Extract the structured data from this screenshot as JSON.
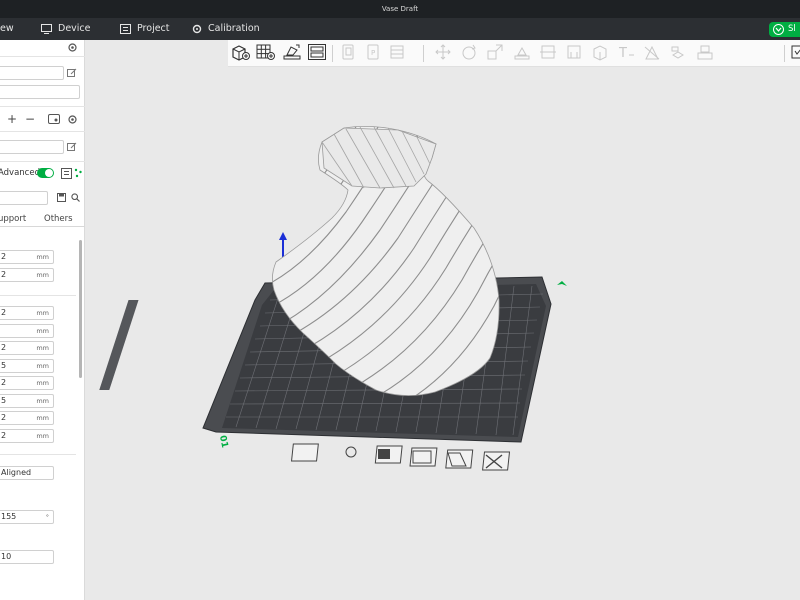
{
  "window": {
    "title": "Vase Draft"
  },
  "menu": {
    "view_label": "ew",
    "device_label": "Device",
    "project_label": "Project",
    "calibration_label": "Calibration",
    "slice_label": "Sl"
  },
  "sidebar": {
    "advanced_label": "Advanced",
    "tabs": {
      "support": "upport",
      "others": "Others"
    },
    "fields": [
      {
        "value": "2",
        "unit": "mm"
      },
      {
        "value": "2",
        "unit": "mm"
      },
      {
        "value": "2",
        "unit": "mm"
      },
      {
        "value": "",
        "unit": "mm"
      },
      {
        "value": "2",
        "unit": "mm"
      },
      {
        "value": "5",
        "unit": "mm"
      },
      {
        "value": "2",
        "unit": "mm"
      },
      {
        "value": "5",
        "unit": "mm"
      },
      {
        "value": "2",
        "unit": "mm"
      },
      {
        "value": "2",
        "unit": "mm"
      }
    ],
    "seam_value": "Aligned",
    "angle_value": "155",
    "angle_unit": "°",
    "count_value": "10"
  },
  "plate": {
    "number_label": "01"
  },
  "colors": {
    "accent": "#00ae42",
    "titlebar": "#1e2124",
    "menubar": "#2c2f33"
  }
}
